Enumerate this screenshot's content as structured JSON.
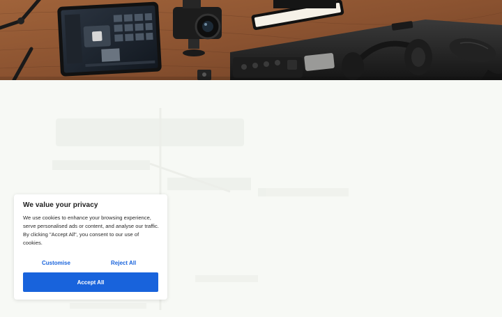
{
  "hero": {
    "image_label": "desk-setup-photo"
  },
  "cookie_banner": {
    "title": "We value your privacy",
    "body": "We use cookies to enhance your browsing experience, serve personalised ads or content, and analyse our traffic. By clicking \"Accept All\", you consent to our use of cookies.",
    "customise_label": "Customise",
    "reject_label": "Reject All",
    "accept_label": "Accept All"
  },
  "colors": {
    "accent": "#1863dc",
    "page_background": "#f7f9f5",
    "banner_background": "#ffffff"
  }
}
